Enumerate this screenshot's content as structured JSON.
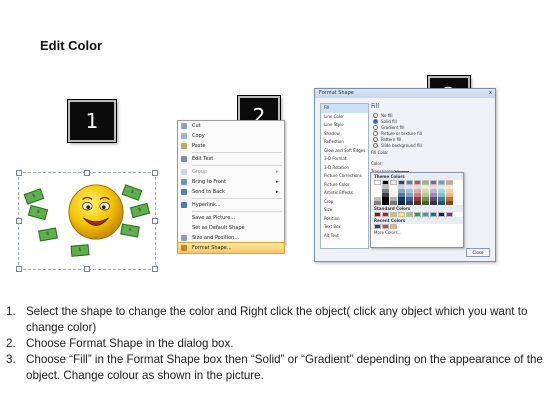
{
  "title": "Edit Color",
  "badges": [
    "1",
    "2",
    "3"
  ],
  "panel1": {
    "bill_label": "$"
  },
  "context_menu": {
    "items": [
      {
        "label": "Cut",
        "icon": "scissors-icon",
        "underline": "t",
        "arrow": ""
      },
      {
        "label": "Copy",
        "icon": "copy-icon",
        "arrow": ""
      },
      {
        "label": "Paste",
        "icon": "paste-icon",
        "arrow": ""
      },
      {
        "label": "Edit Text",
        "icon": "edit-text-icon",
        "arrow": ""
      },
      {
        "label": "Group",
        "icon": "group-icon",
        "arrow": "▸"
      },
      {
        "label": "Bring to Front",
        "icon": "bring-front-icon",
        "arrow": "▸"
      },
      {
        "label": "Send to Back",
        "icon": "send-back-icon",
        "arrow": "▸"
      },
      {
        "label": "Hyperlink...",
        "icon": "hyperlink-icon",
        "arrow": ""
      },
      {
        "label": "Save as Picture...",
        "icon": "",
        "arrow": ""
      },
      {
        "label": "Set as Default Shape",
        "icon": "",
        "arrow": ""
      },
      {
        "label": "Size and Position...",
        "icon": "size-icon",
        "arrow": ""
      },
      {
        "label": "Format Shape...",
        "icon": "format-shape-icon",
        "arrow": ""
      }
    ]
  },
  "dialog": {
    "title": "Format Shape",
    "close": "x",
    "nav": [
      "Fill",
      "Line Color",
      "Line Style",
      "Shadow",
      "Reflection",
      "Glow and Soft Edges",
      "3-D Format",
      "3-D Rotation",
      "Picture Corrections",
      "Picture Color",
      "Artistic Effects",
      "Crop",
      "Size",
      "Position",
      "Text Box",
      "Alt Text"
    ],
    "fill_heading": "Fill",
    "options": [
      "No fill",
      "Solid fill",
      "Gradient fill",
      "Picture or texture fill",
      "Pattern fill",
      "Slide background fill"
    ],
    "fill_color": "Fill Color",
    "color_label": "Color:",
    "transparency_label": "Transparency:",
    "close_button": "Close"
  },
  "picker": {
    "theme_colors": "Theme Colors",
    "standard_colors": "Standard Colors",
    "recent_colors": "Recent Colors",
    "more_colors": "More Colors...",
    "theme_row": [
      "#ffffff",
      "#000000",
      "#eeece1",
      "#1f497d",
      "#4f81bd",
      "#c0504d",
      "#9bbb59",
      "#8064a2",
      "#4bacc6",
      "#f79646"
    ],
    "standard_row": [
      "#c00000",
      "#ff0000",
      "#ffc000",
      "#ffff00",
      "#92d050",
      "#00b050",
      "#00b0f0",
      "#0070c0",
      "#002060",
      "#7030a0"
    ],
    "recent_row": [
      "#1f497d",
      "#c0504d",
      "#ffc000"
    ]
  },
  "instructions": [
    {
      "num": "1.",
      "text": "Select the shape to change the color and Right click the object( click any object which you want to change color)"
    },
    {
      "num": "2.",
      "text": "Choose Format Shape in the dialog box."
    },
    {
      "num": "3.",
      "text": "Choose “Fill” in the Format Shape box then “Solid” or “Gradient” depending on the appearance of the object. Change colour as shown in the picture."
    }
  ]
}
